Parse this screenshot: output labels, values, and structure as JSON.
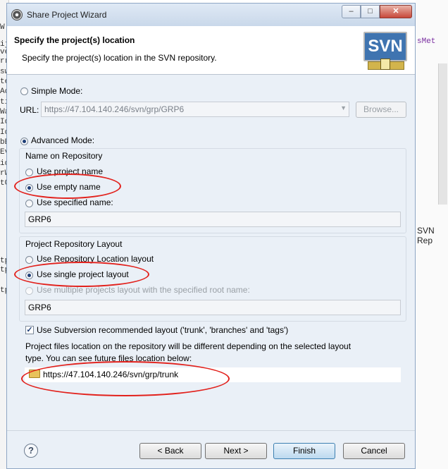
{
  "background": {
    "left_fragments": [
      "W",
      "ij",
      "ve",
      "rr",
      "sw",
      "te",
      "Ac",
      "ti",
      "Wa",
      "Id",
      "Id",
      "bE",
      "Ev",
      "id",
      "rW",
      "tC",
      "tp",
      "tp",
      "tp"
    ],
    "right_code_fragment": "sMet",
    "right_panel_label": "SVN Rep"
  },
  "window": {
    "title": "Share Project Wizard",
    "controls": {
      "minimize": "–",
      "maximize": "□",
      "close": "✕"
    }
  },
  "header": {
    "title": "Specify the project(s) location",
    "description": "Specify the project(s) location in the SVN repository.",
    "logo_text": "SVN"
  },
  "simple_mode": {
    "label": "Simple Mode:",
    "url_label": "URL:",
    "url_value": "https://47.104.140.246/svn/grp/GRP6",
    "browse_label": "Browse..."
  },
  "advanced_mode": {
    "label": "Advanced Mode:",
    "name_group": {
      "title": "Name on Repository",
      "options": [
        "Use project name",
        "Use empty name",
        "Use specified name:"
      ],
      "selected": "Use empty name",
      "specified_value": "GRP6"
    },
    "layout_group": {
      "title": "Project Repository Layout",
      "options": [
        "Use Repository Location layout",
        "Use single project layout",
        "Use multiple projects layout with the specified root name:"
      ],
      "selected": "Use single project layout",
      "root_name_value": "GRP6"
    },
    "recommended_layout_label": "Use Subversion recommended layout ('trunk', 'branches' and 'tags')",
    "recommended_layout_checked": true,
    "info_line1": "Project files location on the repository will be different depending on the selected layout",
    "info_line2": "type. You can see future files location below:",
    "future_location": "https://47.104.140.246/svn/grp/trunk"
  },
  "footer": {
    "help_icon": "?",
    "back": "< Back",
    "next": "Next >",
    "finish": "Finish",
    "cancel": "Cancel"
  },
  "colors": {
    "annotation": "#e2211c",
    "window_bg": "#eaf0f7",
    "svn_logo": "#3f74b0"
  }
}
